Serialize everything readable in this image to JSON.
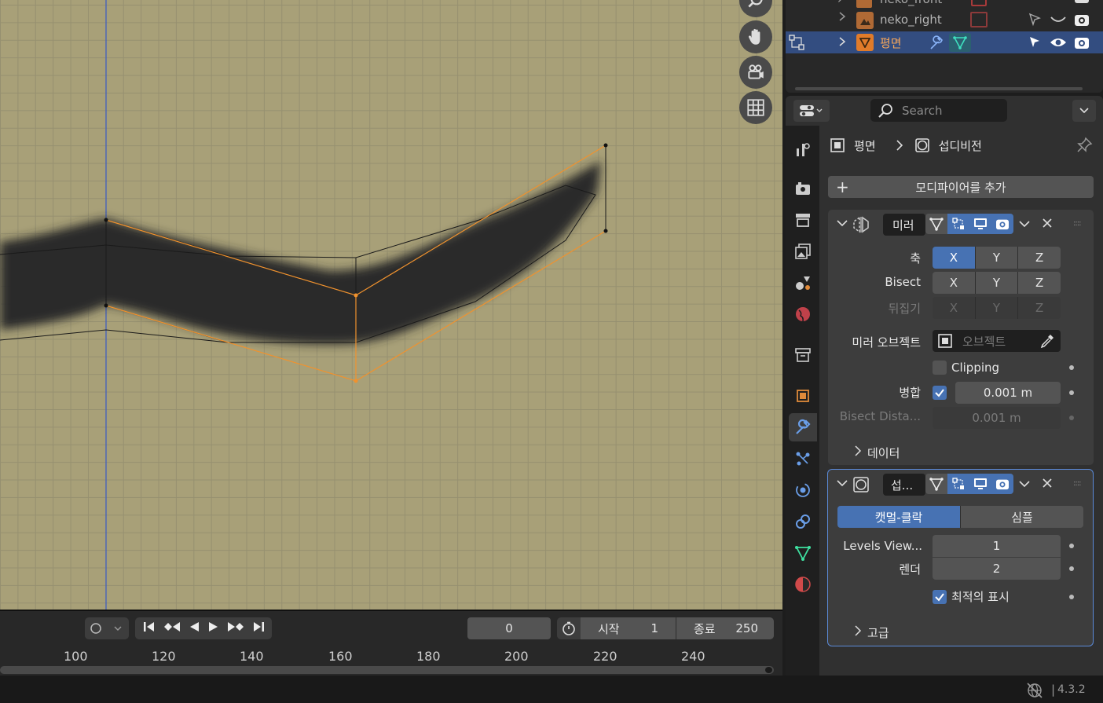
{
  "outliner": {
    "rows": [
      {
        "name": "neko_front"
      },
      {
        "name": "neko_right"
      },
      {
        "name": "평면"
      }
    ]
  },
  "properties": {
    "search_placeholder": "Search",
    "breadcrumb": {
      "object": "평면",
      "modifier": "섭디비전"
    },
    "add_modifier_label": "모디파이어를 추가",
    "mirror": {
      "name": "미러",
      "axis_label": "축",
      "bisect_label": "Bisect",
      "flip_label": "뒤집기",
      "axes": [
        "X",
        "Y",
        "Z"
      ],
      "mirror_object_label": "미러 오브젝트",
      "mirror_object_placeholder": "오브젝트",
      "clipping_label": "Clipping",
      "merge_label": "병합",
      "merge_value": "0.001 m",
      "bisect_distance_label": "Bisect Dista...",
      "bisect_distance_value": "0.001 m",
      "data_label": "데이터"
    },
    "subdiv": {
      "name": "섭...",
      "mode_catmull": "캣멀-클락",
      "mode_simple": "심플",
      "levels_viewport_label": "Levels View...",
      "levels_viewport_value": "1",
      "render_label": "렌더",
      "render_value": "2",
      "optimal_label": "최적의 표시",
      "advanced_label": "고급"
    }
  },
  "timeline": {
    "current_frame": "0",
    "start_label": "시작",
    "start_value": "1",
    "end_label": "종료",
    "end_value": "250",
    "ruler": [
      "100",
      "120",
      "140",
      "160",
      "180",
      "200",
      "220",
      "240"
    ]
  },
  "statusbar": {
    "version": "4.3.2"
  },
  "colors": {
    "accent": "#4772b3",
    "selection_orange": "#f0922e",
    "viewport_bg": "#a8a078"
  }
}
